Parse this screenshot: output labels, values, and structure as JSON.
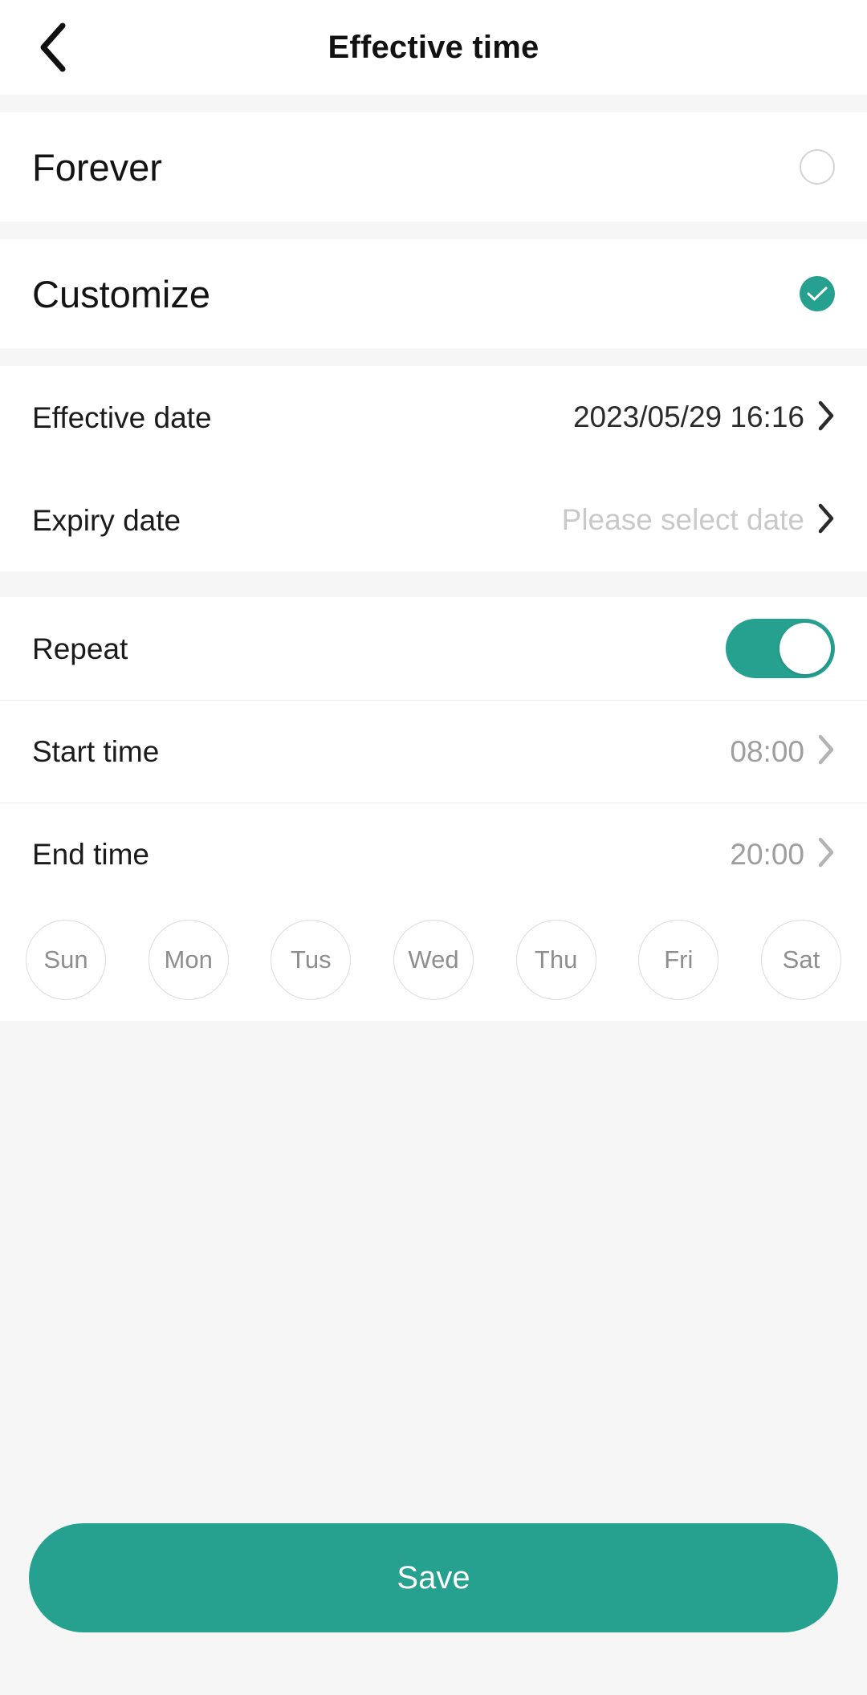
{
  "header": {
    "back_icon": "chevron-left-icon",
    "title": "Effective time"
  },
  "mode_options": [
    {
      "label": "Forever",
      "selected": false
    },
    {
      "label": "Customize",
      "selected": true
    }
  ],
  "date_section": {
    "effective": {
      "label": "Effective date",
      "value": "2023/05/29 16:16",
      "is_placeholder": false,
      "chevron_icon": "chevron-right-icon"
    },
    "expiry": {
      "label": "Expiry date",
      "value": "Please select date",
      "is_placeholder": true,
      "chevron_icon": "chevron-right-icon"
    }
  },
  "repeat_section": {
    "repeat": {
      "label": "Repeat",
      "enabled": true,
      "toggle_icon": "toggle-on-icon"
    },
    "start_time": {
      "label": "Start time",
      "value": "08:00",
      "chevron_icon": "chevron-right-icon"
    },
    "end_time": {
      "label": "End time",
      "value": "20:00",
      "chevron_icon": "chevron-right-icon"
    },
    "weekdays": [
      {
        "label": "Sun",
        "selected": false
      },
      {
        "label": "Mon",
        "selected": false
      },
      {
        "label": "Tus",
        "selected": false
      },
      {
        "label": "Wed",
        "selected": false
      },
      {
        "label": "Thu",
        "selected": false
      },
      {
        "label": "Fri",
        "selected": false
      },
      {
        "label": "Sat",
        "selected": false
      }
    ]
  },
  "footer": {
    "save_label": "Save"
  },
  "colors": {
    "accent": "#26a08f",
    "page_background": "#f6f6f6",
    "card_background": "#ffffff",
    "primary_text": "#1b1b1b",
    "muted_text": "#9e9e9e",
    "placeholder_text": "#c9c9c9"
  }
}
